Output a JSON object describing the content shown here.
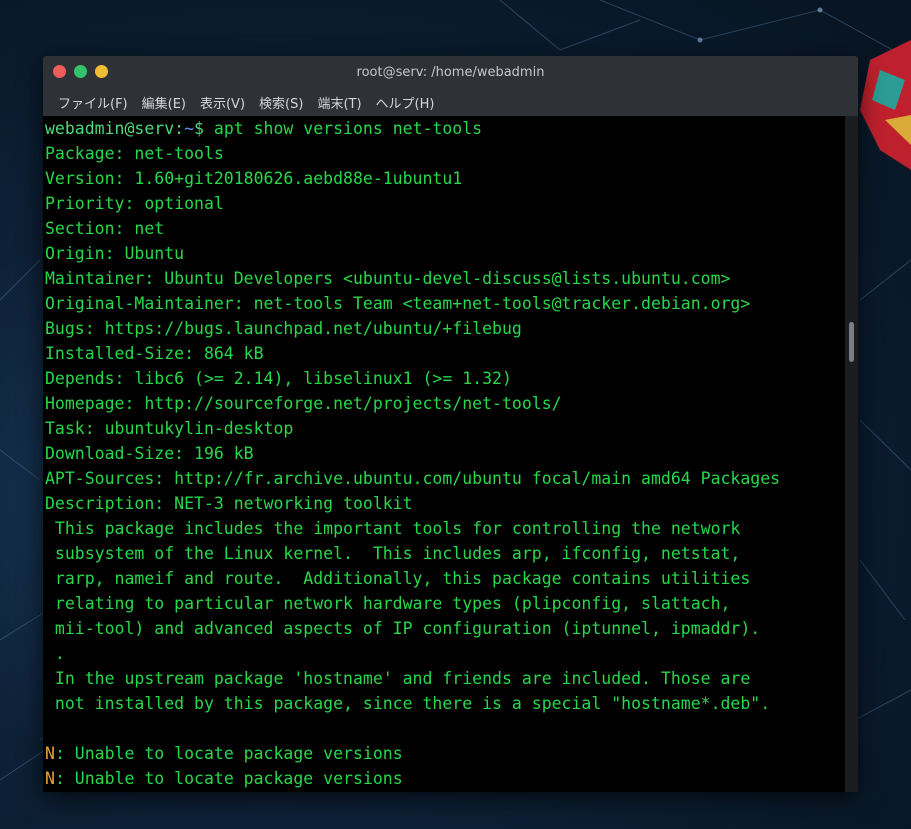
{
  "window": {
    "title": "root@serv: /home/webadmin"
  },
  "menu": [
    "ファイル(F)",
    "編集(E)",
    "表示(V)",
    "検索(S)",
    "端末(T)",
    "ヘルプ(H)"
  ],
  "terminal": {
    "prompt_user": "webadmin@serv",
    "prompt_colon": ":",
    "prompt_path": "~",
    "prompt_symbol": "$ ",
    "command": "apt show versions net-tools",
    "output": [
      "Package: net-tools",
      "Version: 1.60+git20180626.aebd88e-1ubuntu1",
      "Priority: optional",
      "Section: net",
      "Origin: Ubuntu",
      "Maintainer: Ubuntu Developers <ubuntu-devel-discuss@lists.ubuntu.com>",
      "Original-Maintainer: net-tools Team <team+net-tools@tracker.debian.org>",
      "Bugs: https://bugs.launchpad.net/ubuntu/+filebug",
      "Installed-Size: 864 kB",
      "Depends: libc6 (>= 2.14), libselinux1 (>= 1.32)",
      "Homepage: http://sourceforge.net/projects/net-tools/",
      "Task: ubuntukylin-desktop",
      "Download-Size: 196 kB",
      "APT-Sources: http://fr.archive.ubuntu.com/ubuntu focal/main amd64 Packages",
      "Description: NET-3 networking toolkit",
      " This package includes the important tools for controlling the network",
      " subsystem of the Linux kernel.  This includes arp, ifconfig, netstat,",
      " rarp, nameif and route.  Additionally, this package contains utilities",
      " relating to particular network hardware types (plipconfig, slattach,",
      " mii-tool) and advanced aspects of IP configuration (iptunnel, ipmaddr).",
      " .",
      " In the upstream package 'hostname' and friends are included. Those are",
      " not installed by this package, since there is a special \"hostname*.deb\".",
      ""
    ],
    "notices": [
      {
        "prefix": "N",
        "text": ": Unable to locate package versions"
      },
      {
        "prefix": "N",
        "text": ": Unable to locate package versions"
      }
    ]
  },
  "colors": {
    "terminal_text": "#27d84a",
    "notice_prefix": "#e5a43a",
    "prompt_path": "#6e8cff",
    "titlebar": "#2e3136"
  },
  "icons": [
    "close-icon",
    "maximize-icon",
    "minimize-icon"
  ]
}
